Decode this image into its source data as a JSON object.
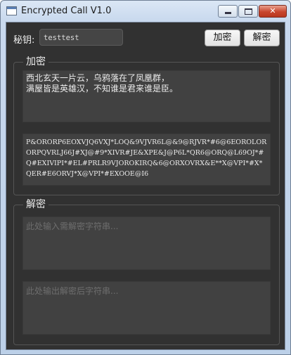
{
  "window": {
    "title": "Encrypted Call V1.0",
    "controls": {
      "minimize": "minimize",
      "maximize": "maximize",
      "close": "✕"
    }
  },
  "key": {
    "label": "秘钥:",
    "value": "testtest"
  },
  "buttons": {
    "encrypt": "加密",
    "decrypt": "解密"
  },
  "encrypt_group": {
    "title": "加密",
    "plaintext": "西北玄天一片云，乌鸦落在了凤凰群，\n满屋皆是英雄汉，不知谁是君来谁是臣。",
    "ciphertext": "P&ORORP6EOXVJQ6VXJ*LOQ&9VJVR6L@&9@RJVR*#6@6EOROLORORPQVRLJ66J#XJ@#9*XIVR#JE&XPE&J@P6L*QR6@ORQ@L69OJ*#Q#EXIVIPI*#EL#PRLR9VJOROKIRQ&6@ORXOVRX&E**X@VPI*#X*QER#E6ORVJ*X@VPI*#EXOOE@I6"
  },
  "decrypt_group": {
    "title": "解密",
    "input_placeholder": "此处输入需解密字符串...",
    "output_placeholder": "此处输出解密后字符串..."
  }
}
